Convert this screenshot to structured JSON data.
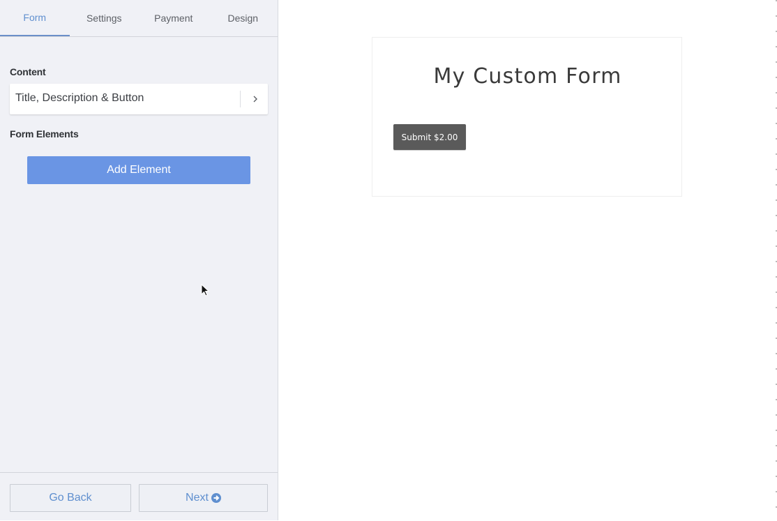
{
  "sidebar": {
    "tabs": [
      {
        "label": "Form",
        "active": true
      },
      {
        "label": "Settings",
        "active": false
      },
      {
        "label": "Payment",
        "active": false
      },
      {
        "label": "Design",
        "active": false
      }
    ],
    "content_section": {
      "label": "Content",
      "row_text": "Title, Description & Button",
      "row_icon": "chevron-right-icon"
    },
    "form_elements_section": {
      "label": "Form Elements",
      "add_button_label": "Add Element"
    },
    "footer": {
      "back_label": "Go Back",
      "next_label": "Next",
      "next_icon": "arrow-circle-right-icon"
    }
  },
  "preview": {
    "form_title": "My Custom Form",
    "submit_label": "Submit $2.00"
  },
  "colors": {
    "accent": "#6a95e4",
    "tab_active": "#5f8fcf",
    "sidebar_bg": "#f0f1f6",
    "submit_bg": "#5a5a5a"
  }
}
